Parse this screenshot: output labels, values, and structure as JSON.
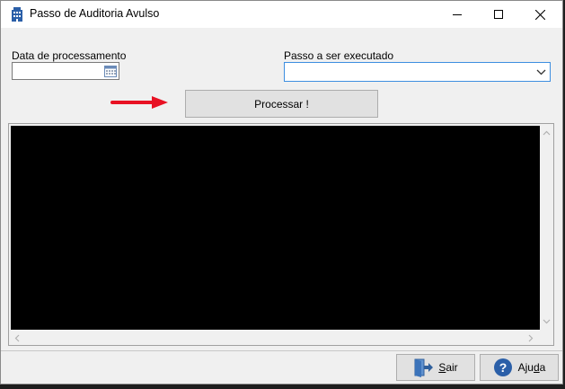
{
  "window": {
    "title": "Passo de Auditoria Avulso"
  },
  "form": {
    "date_label": "Data de processamento",
    "date_value": "",
    "step_label": "Passo a ser executado",
    "step_value": ""
  },
  "actions": {
    "process_label": "Processar !"
  },
  "footer": {
    "exit_pre": "",
    "exit_mnemonic": "S",
    "exit_post": "air",
    "help_pre": "Aju",
    "help_mnemonic": "d",
    "help_post": "a"
  },
  "colors": {
    "annotation_arrow": "#e81123",
    "output_background": "#000000",
    "combo_focus_border": "#3d8ee0"
  },
  "icons": {
    "app": "building-icon",
    "minimize": "minimize-icon",
    "maximize": "maximize-icon",
    "close": "close-icon",
    "calendar": "calendar-icon",
    "dropdown": "chevron-down-icon",
    "exit": "exit-door-icon",
    "help": "help-icon"
  }
}
